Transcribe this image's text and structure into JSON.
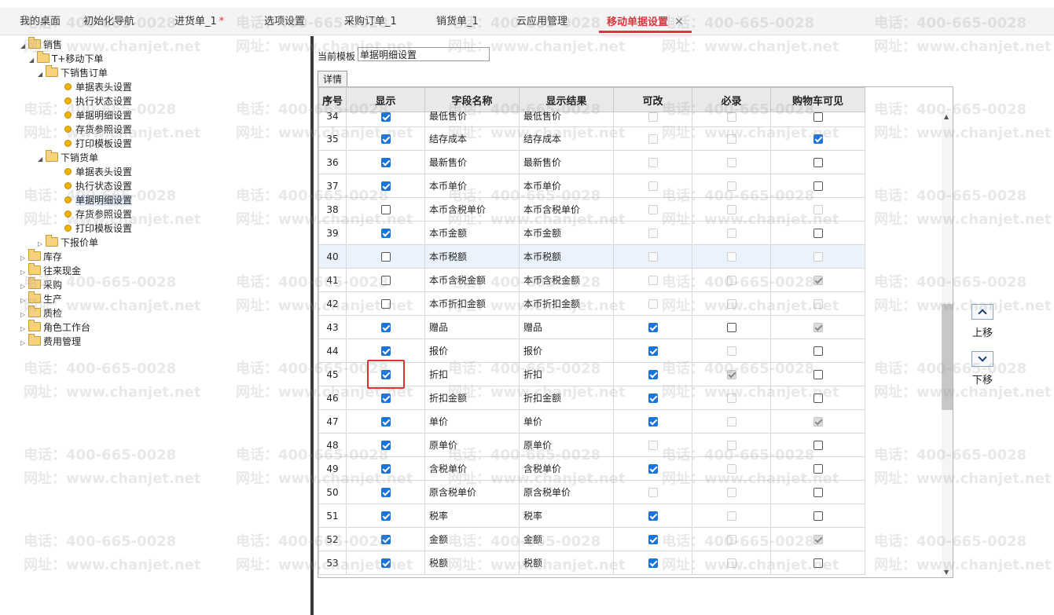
{
  "tabs": [
    {
      "label": "我的桌面",
      "active": false,
      "dirty": false
    },
    {
      "label": "初始化导航",
      "active": false,
      "dirty": false
    },
    {
      "label": "进货单_1",
      "active": false,
      "dirty": true
    },
    {
      "label": "选项设置",
      "active": false,
      "dirty": false
    },
    {
      "label": "采购订单_1",
      "active": false,
      "dirty": false
    },
    {
      "label": "销货单_1",
      "active": false,
      "dirty": false
    },
    {
      "label": "云应用管理",
      "active": false,
      "dirty": false
    },
    {
      "label": "移动单据设置",
      "active": true,
      "dirty": false
    }
  ],
  "dirty_mark": "*",
  "close_glyph": "✕",
  "tree": [
    {
      "label": "销售",
      "level": 0,
      "type": "folder",
      "arrow": "◢"
    },
    {
      "label": "T+移动下单",
      "level": 1,
      "type": "folder",
      "arrow": "◢"
    },
    {
      "label": "下销售订单",
      "level": 2,
      "type": "folder",
      "arrow": "◢"
    },
    {
      "label": "单据表头设置",
      "level": 3,
      "type": "leaf"
    },
    {
      "label": "执行状态设置",
      "level": 3,
      "type": "leaf"
    },
    {
      "label": "单据明细设置",
      "level": 3,
      "type": "leaf"
    },
    {
      "label": "存货参照设置",
      "level": 3,
      "type": "leaf"
    },
    {
      "label": "打印模板设置",
      "level": 3,
      "type": "leaf"
    },
    {
      "label": "下销货单",
      "level": 2,
      "type": "folder",
      "arrow": "◢"
    },
    {
      "label": "单据表头设置",
      "level": 3,
      "type": "leaf"
    },
    {
      "label": "执行状态设置",
      "level": 3,
      "type": "leaf"
    },
    {
      "label": "单据明细设置",
      "level": 3,
      "type": "leaf",
      "selected": true
    },
    {
      "label": "存货参照设置",
      "level": 3,
      "type": "leaf"
    },
    {
      "label": "打印模板设置",
      "level": 3,
      "type": "leaf"
    },
    {
      "label": "下报价单",
      "level": 2,
      "type": "folder",
      "arrow": "▷"
    },
    {
      "label": "库存",
      "level": 0,
      "type": "folder",
      "arrow": "▷"
    },
    {
      "label": "往来现金",
      "level": 0,
      "type": "folder",
      "arrow": "▷"
    },
    {
      "label": "采购",
      "level": 0,
      "type": "folder",
      "arrow": "▷"
    },
    {
      "label": "生产",
      "level": 0,
      "type": "folder",
      "arrow": "▷"
    },
    {
      "label": "质检",
      "level": 0,
      "type": "folder",
      "arrow": "▷"
    },
    {
      "label": "角色工作台",
      "level": 0,
      "type": "folder",
      "arrow": "▷"
    },
    {
      "label": "费用管理",
      "level": 0,
      "type": "folder",
      "arrow": "▷"
    }
  ],
  "template": {
    "label": "当前模板",
    "value": "单据明细设置"
  },
  "detail_tab": "详情",
  "columns": [
    "序号",
    "显示",
    "字段名称",
    "显示结果",
    "可改",
    "必录",
    "购物车可见"
  ],
  "rows": [
    {
      "no": "34",
      "show": "on",
      "field": "最低售价",
      "result": "最低售价",
      "editable": "dis",
      "required": "dis",
      "cart": "off"
    },
    {
      "no": "35",
      "show": "on",
      "field": "结存成本",
      "result": "结存成本",
      "editable": "dis",
      "required": "dis",
      "cart": "on"
    },
    {
      "no": "36",
      "show": "on",
      "field": "最新售价",
      "result": "最新售价",
      "editable": "dis",
      "required": "dis",
      "cart": "off"
    },
    {
      "no": "37",
      "show": "on",
      "field": "本币单价",
      "result": "本币单价",
      "editable": "dis",
      "required": "dis",
      "cart": "off"
    },
    {
      "no": "38",
      "show": "off",
      "field": "本币含税单价",
      "result": "本币含税单价",
      "editable": "dis",
      "required": "dis",
      "cart": "dis"
    },
    {
      "no": "39",
      "show": "on",
      "field": "本币金额",
      "result": "本币金额",
      "editable": "dis",
      "required": "dis",
      "cart": "off"
    },
    {
      "no": "40",
      "show": "off",
      "field": "本币税额",
      "result": "本币税额",
      "editable": "dis",
      "required": "dis",
      "cart": "dis"
    },
    {
      "no": "41",
      "show": "off",
      "field": "本币含税金额",
      "result": "本币含税金额",
      "editable": "dis",
      "required": "dis",
      "cart": "dison"
    },
    {
      "no": "42",
      "show": "off",
      "field": "本币折扣金额",
      "result": "本币折扣金额",
      "editable": "dis",
      "required": "dis",
      "cart": "dis"
    },
    {
      "no": "43",
      "show": "on",
      "field": "赠品",
      "result": "赠品",
      "editable": "on",
      "required": "off",
      "cart": "dison"
    },
    {
      "no": "44",
      "show": "on",
      "field": "报价",
      "result": "报价",
      "editable": "on",
      "required": "dis",
      "cart": "off"
    },
    {
      "no": "45",
      "show": "on",
      "field": "折扣",
      "result": "折扣",
      "editable": "on",
      "required": "dison",
      "cart": "off"
    },
    {
      "no": "46",
      "show": "on",
      "field": "折扣金额",
      "result": "折扣金额",
      "editable": "on",
      "required": "dis",
      "cart": "off"
    },
    {
      "no": "47",
      "show": "on",
      "field": "单价",
      "result": "单价",
      "editable": "on",
      "required": "dis",
      "cart": "dison"
    },
    {
      "no": "48",
      "show": "on",
      "field": "原单价",
      "result": "原单价",
      "editable": "dis",
      "required": "dis",
      "cart": "off"
    },
    {
      "no": "49",
      "show": "on",
      "field": "含税单价",
      "result": "含税单价",
      "editable": "on",
      "required": "dis",
      "cart": "off"
    },
    {
      "no": "50",
      "show": "on",
      "field": "原含税单价",
      "result": "原含税单价",
      "editable": "dis",
      "required": "dis",
      "cart": "off"
    },
    {
      "no": "51",
      "show": "on",
      "field": "税率",
      "result": "税率",
      "editable": "on",
      "required": "dis",
      "cart": "off"
    },
    {
      "no": "52",
      "show": "on",
      "field": "金额",
      "result": "金额",
      "editable": "on",
      "required": "dis",
      "cart": "dison"
    },
    {
      "no": "53",
      "show": "on",
      "field": "税额",
      "result": "税额",
      "editable": "on",
      "required": "dis",
      "cart": "off"
    }
  ],
  "buttons": {
    "up": "上移",
    "down": "下移"
  },
  "watermark": {
    "phone": "电话：400-665-0028",
    "site": "网址：www.chanjet.net"
  }
}
